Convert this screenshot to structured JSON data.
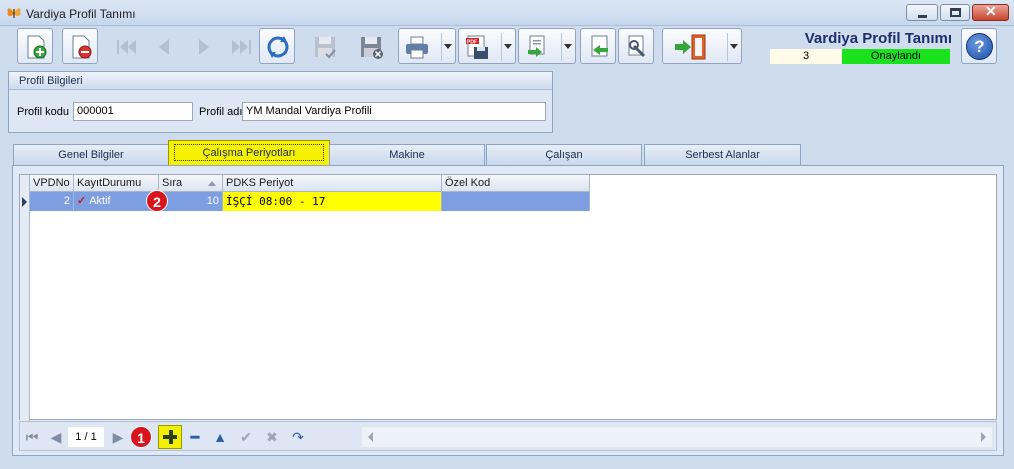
{
  "window": {
    "title": "Vardiya Profil Tanımı"
  },
  "header": {
    "title": "Vardiya Profil Tanımı",
    "record_count": "3",
    "status": "Onaylandı",
    "status_color": "#19e21d"
  },
  "toolbar": {
    "icons": [
      "new-document-icon",
      "delete-document-icon",
      "first-record-icon",
      "previous-record-icon",
      "next-record-icon",
      "last-record-icon",
      "refresh-icon",
      "save-icon",
      "cancel-save-icon",
      "print-icon",
      "pdf-export-icon",
      "export-icon",
      "import-icon",
      "tools-icon",
      "exit-icon",
      "help-icon"
    ]
  },
  "profile": {
    "group_title": "Profil Bilgileri",
    "code_label": "Profil kodu",
    "code_value": "000001",
    "name_label": "Profil adı",
    "name_value": "YM Mandal Vardiya Profili"
  },
  "tabs": [
    {
      "label": "Genel Bilgiler"
    },
    {
      "label": "Çalışma Periyotları",
      "active": true
    },
    {
      "label": "Makine"
    },
    {
      "label": "Çalışan"
    },
    {
      "label": "Serbest Alanlar"
    }
  ],
  "grid": {
    "columns": [
      "VPDNo",
      "KayıtDurumu",
      "Sıra",
      "PDKS Periyot",
      "Özel Kod"
    ],
    "rows": [
      {
        "vpdno": "2",
        "kayit_durumu": "Aktif",
        "sira": "10",
        "pdks_periyot": "İŞÇİ 08:00 - 17",
        "ozel_kod": ""
      }
    ]
  },
  "navigator": {
    "page": "1 / 1"
  },
  "annotations": {
    "badge1": "1",
    "badge2": "2",
    "highlight_color": "#f5f100"
  }
}
